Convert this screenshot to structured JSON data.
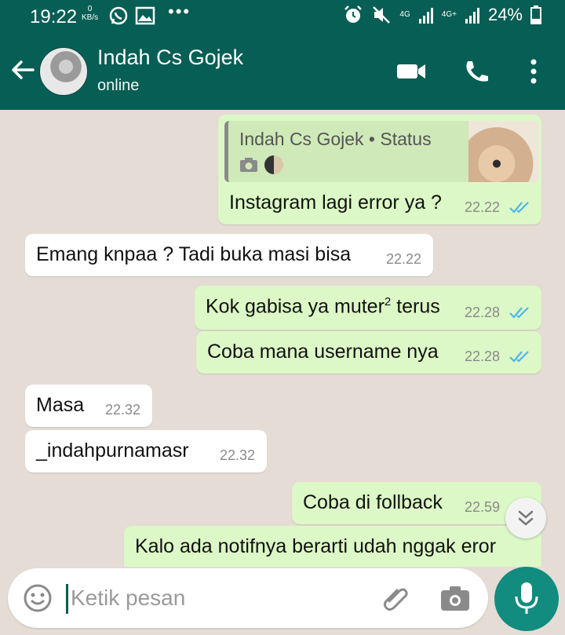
{
  "status_bar": {
    "time": "19:22",
    "net_speed_value": "0",
    "net_speed_unit": "KB/s",
    "dots": "•••",
    "net_type_1": "4G",
    "net_type_2": "4G+",
    "battery_percent": "24%"
  },
  "header": {
    "contact_name": "Indah Cs Gojek",
    "contact_status": "online"
  },
  "messages": [
    {
      "direction": "out",
      "quote_name": "Indah Cs Gojek • Status",
      "text": "Instagram lagi error ya ?",
      "time": "22.22",
      "ticks": "read"
    },
    {
      "direction": "in",
      "text": "Emang knpaa ? Tadi buka masi bisa",
      "time": "22.22"
    },
    {
      "direction": "out",
      "text_before_sup": "Kok gabisa ya muter",
      "sup": "2",
      "text_after_sup": " terus",
      "time": "22.28",
      "ticks": "read"
    },
    {
      "direction": "out",
      "text": "Coba mana username nya",
      "time": "22.28",
      "ticks": "read"
    },
    {
      "direction": "in",
      "text": "Masa",
      "time": "22.32"
    },
    {
      "direction": "in",
      "text": "_indahpurnamasr",
      "time": "22.32"
    },
    {
      "direction": "out",
      "text": "Coba di follback",
      "time": "22.59"
    },
    {
      "direction": "out",
      "text": "Kalo ada notifnya berarti udah nggak eror"
    }
  ],
  "input": {
    "placeholder": "Ketik pesan",
    "value": ""
  },
  "colors": {
    "header": "#075e54",
    "outgoing_bubble": "#dcf8c6",
    "incoming_bubble": "#ffffff",
    "read_tick": "#4fb6ec",
    "fab": "#128c7e",
    "chat_background": "#e5ddd5"
  },
  "icons": [
    "whatsapp-icon",
    "gallery-icon",
    "alarm-icon",
    "mute-icon",
    "signal-icon",
    "battery-icon",
    "back-arrow-icon",
    "video-call-icon",
    "phone-icon",
    "more-options-icon",
    "camera-icon",
    "double-check-icon",
    "chevron-down-icon",
    "emoji-icon",
    "attach-icon",
    "mic-icon"
  ]
}
